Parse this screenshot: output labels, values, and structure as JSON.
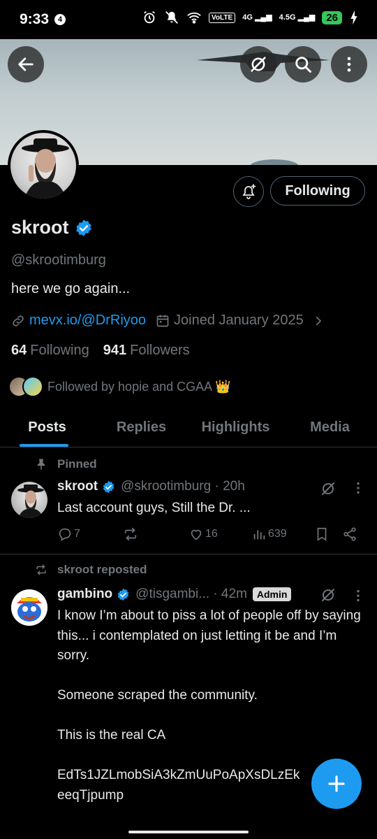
{
  "status_bar": {
    "time": "9:33",
    "notification_count": "4",
    "volte": "VoLTE",
    "sim1_net": "4G",
    "sim2_net": "4.5G",
    "battery": "26"
  },
  "profile": {
    "display_name": "skroot",
    "handle": "@skrootimburg",
    "bio": "here we go again...",
    "link": "mevx.io/@DrRiyoo",
    "joined": "Joined January 2025",
    "following_count": "64",
    "following_label": "Following",
    "followers_count": "941",
    "followers_label": "Followers",
    "followed_by": "Followed by hopie and CGAA 👑",
    "follow_button": "Following"
  },
  "tabs": [
    {
      "label": "Posts",
      "active": true
    },
    {
      "label": "Replies",
      "active": false
    },
    {
      "label": "Highlights",
      "active": false
    },
    {
      "label": "Media",
      "active": false
    }
  ],
  "posts": [
    {
      "context": "Pinned",
      "name": "skroot",
      "handle_time": "@skrootimburg · 20h",
      "text": "Last account guys, Still the Dr. ...",
      "replies": "7",
      "reposts": "",
      "likes": "16",
      "views": "639"
    },
    {
      "context": "skroot reposted",
      "name": "gambino",
      "handle_time": "@tisgambi... · 42m",
      "badge": "Admin",
      "text": "I know I’m about to piss a lot of people off by saying this... i contemplated on just letting it be and I’m sorry.\n\nSomeone scraped the community.\n\nThis is the real CA\n\nEdTs1JZLmobSiA3kZmUuPoApXsDLzEk\neeqTjpump"
    }
  ],
  "colors": {
    "accent": "#1d9bf0",
    "text_primary": "#e7e9ea",
    "text_secondary": "#71767b",
    "background": "#000000"
  }
}
